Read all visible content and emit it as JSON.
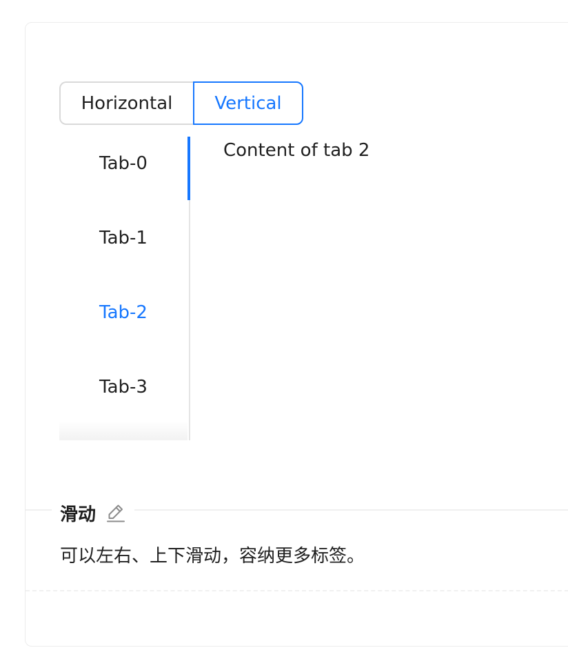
{
  "mode_switch": {
    "options": [
      "Horizontal",
      "Vertical"
    ],
    "selected": "Vertical"
  },
  "tabs": {
    "items": [
      "Tab-0",
      "Tab-1",
      "Tab-2",
      "Tab-3"
    ],
    "active_index": 2,
    "content": "Content of tab 2"
  },
  "meta": {
    "title": "滑动",
    "description": "可以左右、上下滑动，容纳更多标签。",
    "edit_icon": "edit-icon"
  },
  "colors": {
    "accent": "#1677ff",
    "border": "#d9d9d9",
    "divider": "#efefef"
  }
}
